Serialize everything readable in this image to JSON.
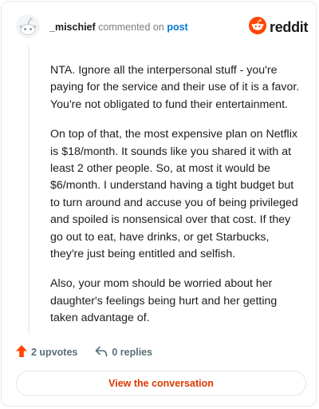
{
  "header": {
    "username": "_mischief",
    "action_text": "commented on",
    "post_link": "post",
    "logo_text": "reddit"
  },
  "comment": {
    "paragraphs": [
      "NTA. Ignore all the interpersonal stuff - you're paying for the service and their use of it is a favor. You're not obligated to fund their entertainment.",
      "On top of that, the most expensive plan on Netflix is $18/month. It sounds like you shared it with at least 2 other people. So, at most it would be $6/month. I understand having a tight budget but to turn around and accuse you of being privileged and spoiled is nonsensical over that cost. If they go out to eat, have drinks, or get Starbucks, they're just being entitled and selfish.",
      "Also, your mom should be worried about her daughter's feelings being hurt and her getting taken advantage of."
    ]
  },
  "actions": {
    "upvotes": "2 upvotes",
    "replies": "0 replies"
  },
  "view_button": "View the conversation",
  "colors": {
    "brand": "#ff4500",
    "link": "#0079d3",
    "cta": "#d93a00"
  },
  "icons": {
    "avatar": "snoo-avatar-icon",
    "logo": "reddit-logo-icon",
    "upvote": "upvote-arrow-icon",
    "reply": "reply-arrow-icon"
  }
}
